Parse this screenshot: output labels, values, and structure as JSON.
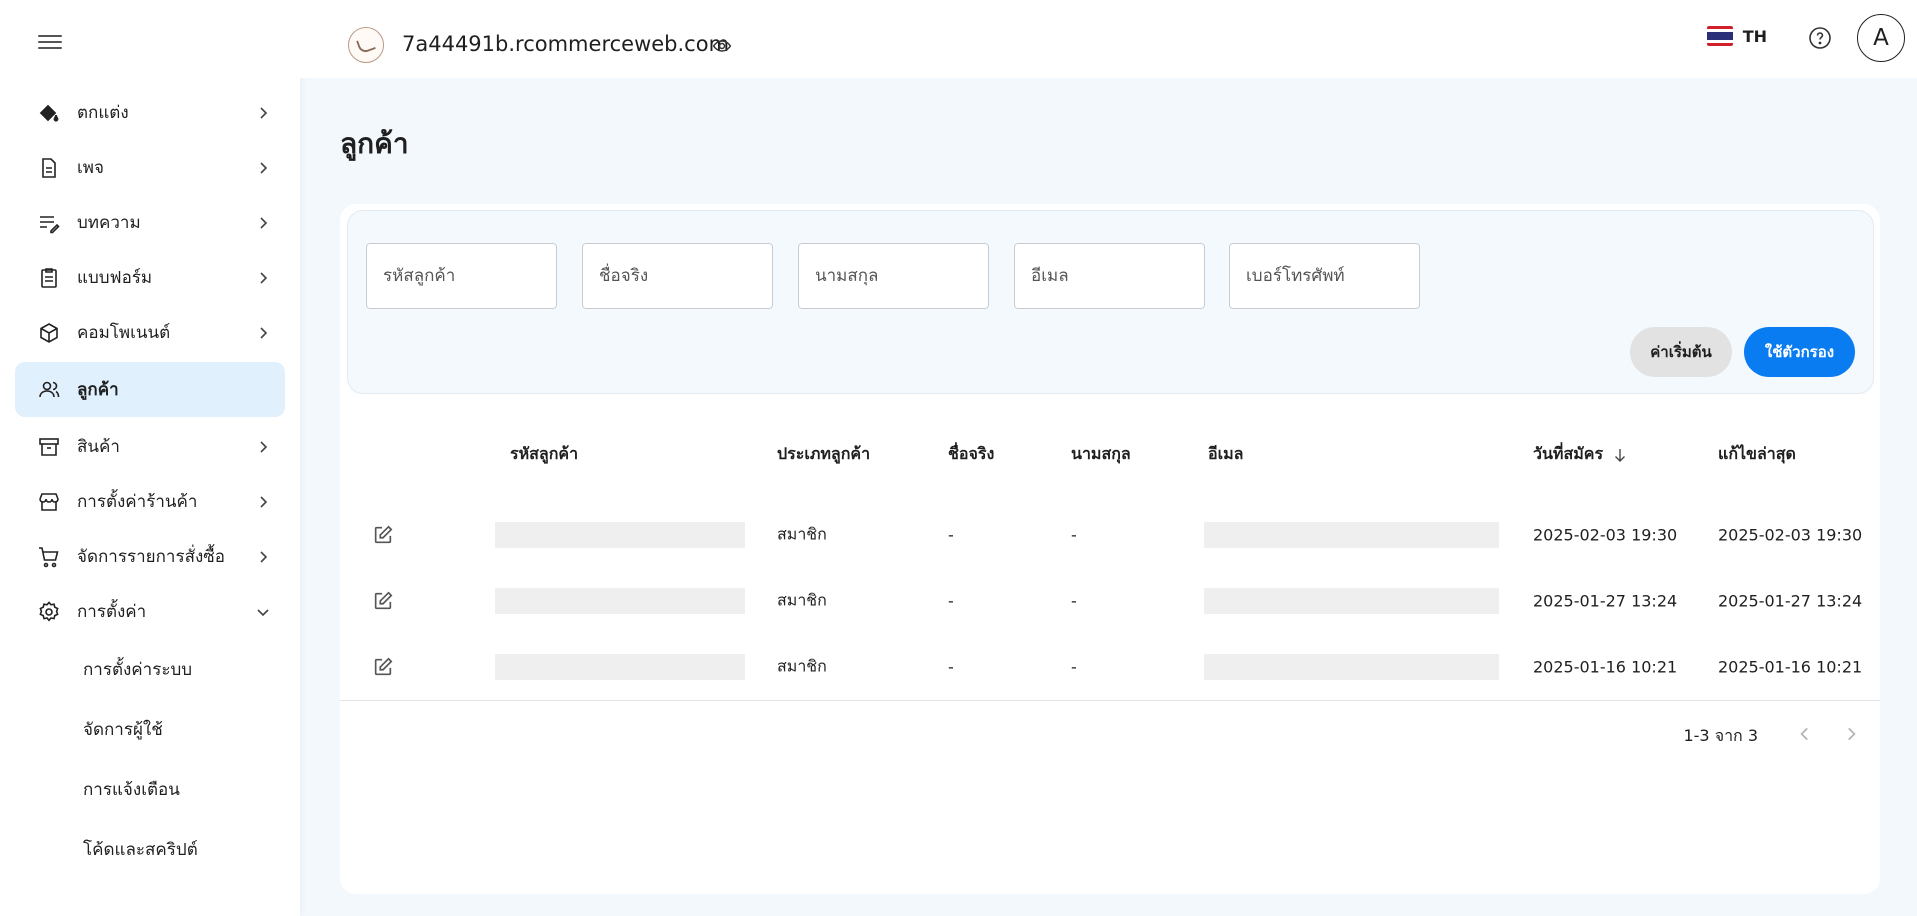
{
  "sidebar": {
    "items": [
      {
        "label": "ตกแต่ง",
        "icon": "paint-bucket-icon",
        "chevron": "right"
      },
      {
        "label": "เพจ",
        "icon": "document-icon",
        "chevron": "right"
      },
      {
        "label": "บทความ",
        "icon": "article-edit-icon",
        "chevron": "right"
      },
      {
        "label": "แบบฟอร์ม",
        "icon": "clipboard-icon",
        "chevron": "right"
      },
      {
        "label": "คอมโพเนนต์",
        "icon": "cube-icon",
        "chevron": "right"
      },
      {
        "label": "ลูกค้า",
        "icon": "users-icon",
        "chevron": "",
        "active": true
      },
      {
        "label": "สินค้า",
        "icon": "archive-box-icon",
        "chevron": "right"
      },
      {
        "label": "การตั้งค่าร้านค้า",
        "icon": "storefront-icon",
        "chevron": "right"
      },
      {
        "label": "จัดการรายการสั่งซื้อ",
        "icon": "cart-icon",
        "chevron": "right"
      },
      {
        "label": "การตั้งค่า",
        "icon": "gear-icon",
        "chevron": "down"
      }
    ],
    "sub_items": [
      "การตั้งค่าระบบ",
      "จัดการผู้ใช้",
      "การแจ้งเตือน",
      "โค้ดและสคริปต์"
    ]
  },
  "header": {
    "domain": "7a44491b.rcommerceweb.com",
    "language": "TH",
    "avatar_initial": "A"
  },
  "page": {
    "title": "ลูกค้า"
  },
  "filters": {
    "customer_id_placeholder": "รหัสลูกค้า",
    "first_name_placeholder": "ชื่อจริง",
    "last_name_placeholder": "นามสกุล",
    "email_placeholder": "อีเมล",
    "phone_placeholder": "เบอร์โทรศัพท์",
    "reset_label": "ค่าเริ่มต้น",
    "apply_label": "ใช้ตัวกรอง"
  },
  "table": {
    "headers": {
      "customer_id": "รหัสลูกค้า",
      "customer_type": "ประเภทลูกค้า",
      "first_name": "ชื่อจริง",
      "last_name": "นามสกุล",
      "email": "อีเมล",
      "registered": "วันที่สมัคร",
      "updated": "แก้ไขล่าสุด"
    },
    "rows": [
      {
        "type": "สมาชิก",
        "first_name": "-",
        "last_name": "-",
        "registered": "2025-02-03 19:30",
        "updated": "2025-02-03 19:30"
      },
      {
        "type": "สมาชิก",
        "first_name": "-",
        "last_name": "-",
        "registered": "2025-01-27 13:24",
        "updated": "2025-01-27 13:24"
      },
      {
        "type": "สมาชิก",
        "first_name": "-",
        "last_name": "-",
        "registered": "2025-01-16 10:21",
        "updated": "2025-01-16 10:21"
      }
    ]
  },
  "pagination": {
    "text": "1-3 จาก 3"
  },
  "colors": {
    "accent": "#0a7cf2",
    "active_nav_bg": "#e1f0fd",
    "page_bg": "#f3f8fc"
  }
}
